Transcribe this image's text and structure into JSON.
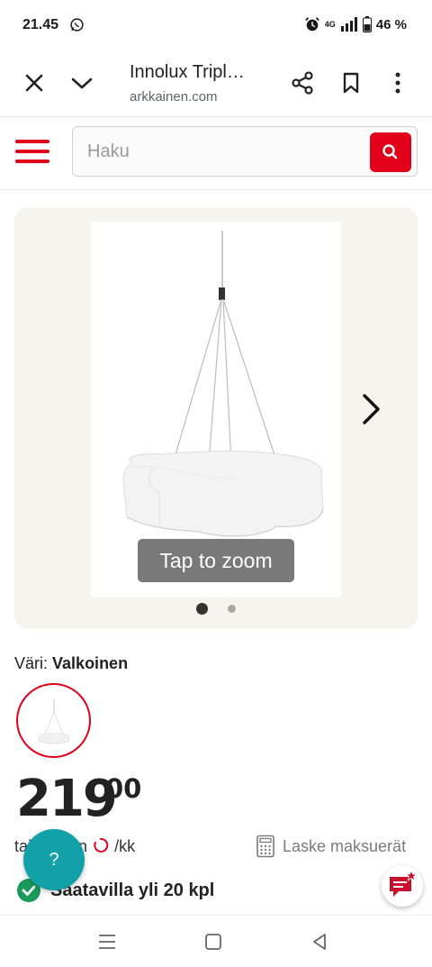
{
  "status_bar": {
    "time": "21.45",
    "network": "4G",
    "battery": "46 %"
  },
  "browser": {
    "title": "Innolux Tripl…",
    "url": "arkkainen.com"
  },
  "site": {
    "search_placeholder": "Haku",
    "accent_color": "#e2001a"
  },
  "gallery": {
    "zoom_label": "Tap to zoom",
    "image_count": 2,
    "current_image": 1
  },
  "product": {
    "color_label": "Väri:",
    "color_value": "Valkoinen",
    "price_integer": "219",
    "price_decimals": "00",
    "monthly_prefix": "tai",
    "monthly_infix": "n",
    "monthly_suffix": "/kk",
    "installments_label": "Laske maksuerät",
    "availability": "Saatavilla yli 20 kpl"
  },
  "widgets": {
    "help_label": "?"
  }
}
